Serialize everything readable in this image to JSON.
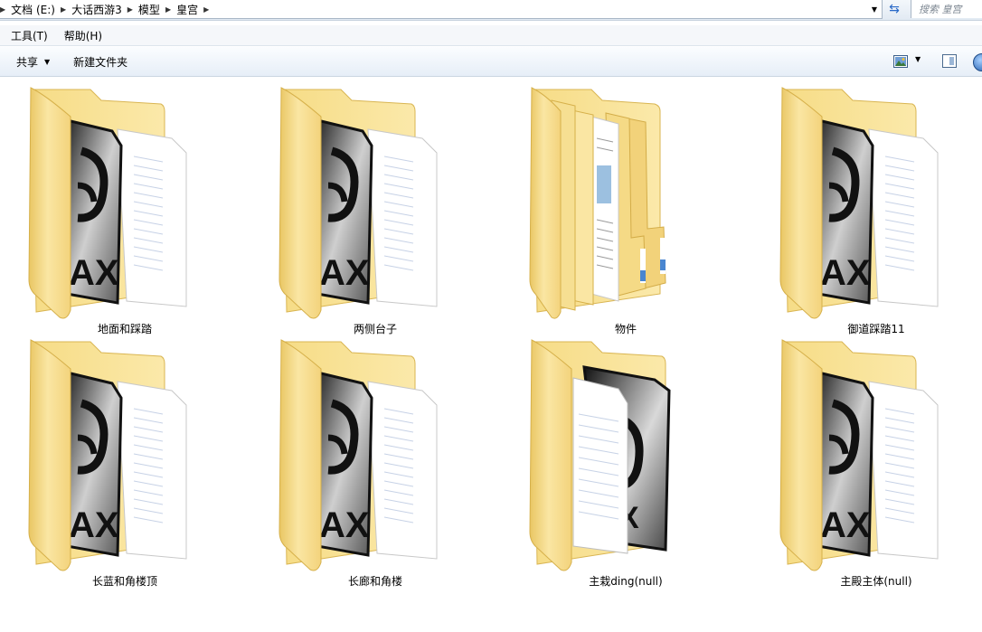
{
  "address": {
    "crumbs": [
      "文档 (E:)",
      "大话西游3",
      "模型",
      "皇宫"
    ],
    "search_placeholder": "搜索 皇宫"
  },
  "menu": [
    "工具(T)",
    "帮助(H)"
  ],
  "toolbar": {
    "share_label": "共享",
    "new_folder_label": "新建文件夹"
  },
  "folders": [
    {
      "name": "地面和踩踏",
      "kind": "max"
    },
    {
      "name": "两侧台子",
      "kind": "max"
    },
    {
      "name": "物件",
      "kind": "docs"
    },
    {
      "name": "御道踩踏11",
      "kind": "max"
    },
    {
      "name": "长蓝和角楼顶",
      "kind": "max"
    },
    {
      "name": "长廊和角楼",
      "kind": "max"
    },
    {
      "name": "主栽ding(null)",
      "kind": "max-flipped"
    },
    {
      "name": "主殿主体(null)",
      "kind": "max"
    }
  ],
  "colors": {
    "folder_light": "#fbe7a1",
    "folder_dark": "#e8c662",
    "accent_blue": "#2a6ac8"
  }
}
